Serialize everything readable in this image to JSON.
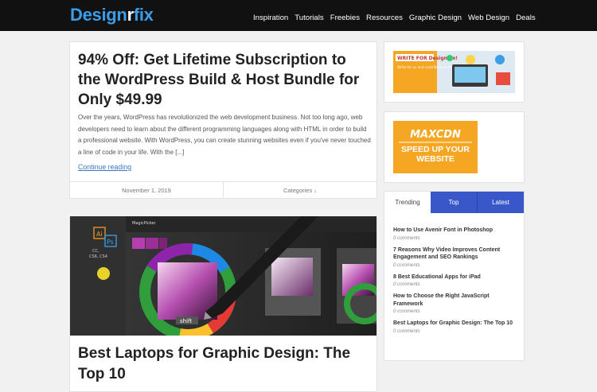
{
  "header": {
    "logo_main": "Design",
    "logo_r": "r",
    "logo_end": "fix",
    "nav": [
      "Inspiration",
      "Tutorials",
      "Freebies",
      "Resources",
      "Graphic Design",
      "Web Design",
      "Deals"
    ]
  },
  "posts": [
    {
      "title": "94% Off: Get Lifetime Subscription to the WordPress Build & Host Bundle for Only $49.99",
      "excerpt": "Over the years, WordPress has revolutionized the web development business. Not too long ago, web developers need to learn about the different programming languages along with HTML in order to build a professional website. With WordPress, you can create stunning websites even if you've never touched a line of code in your life. With the [...]",
      "read_more": "Continue reading",
      "date": "November 1, 2019",
      "categories": "Categories ↓"
    },
    {
      "title": "Best Laptops for Graphic Design: The Top 10",
      "image_text": "MagicPicker",
      "image_labels": [
        "Ai",
        "Ps",
        "CC,",
        "CS6, CS4",
        "shift"
      ]
    }
  ],
  "sidebar": {
    "ad1": {
      "heading": "WRITE FOR Design fix!",
      "body": "Write for us and contribute to the community."
    },
    "ad2": {
      "brand": "MAXCDN",
      "cta": "SPEED UP YOUR WEBSITE"
    },
    "tabs": [
      "Trending",
      "Top",
      "Latest"
    ],
    "trending": [
      {
        "title": "How to Use Avenir Font in Photoshop",
        "comments": "0 comments"
      },
      {
        "title": "7 Reasons Why Video Improves Content Engagement and SEO Rankings",
        "comments": "0 comments"
      },
      {
        "title": "8 Best Educational Apps for iPad",
        "comments": "0 comments"
      },
      {
        "title": "How to Choose the Right JavaScript Framework",
        "comments": "0 comments"
      },
      {
        "title": "Best Laptops for Graphic Design: The Top 10",
        "comments": "0 comments"
      }
    ]
  },
  "colors": {
    "header_bg": "#111111",
    "logo_blue": "#3d9ce8",
    "tab_blue": "#3a57c9",
    "ad_orange": "#f5a623",
    "link": "#3d78c4"
  }
}
